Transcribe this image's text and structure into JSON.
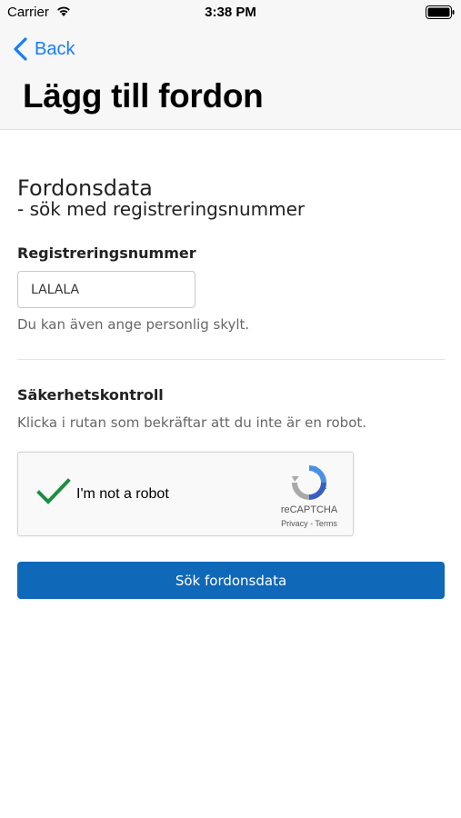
{
  "status_bar": {
    "carrier": "Carrier",
    "time": "3:38 PM",
    "wifi_icon": "wifi-icon",
    "battery_icon": "battery-icon"
  },
  "nav": {
    "back_label": "Back",
    "back_icon": "chevron-left-icon",
    "title": "Lägg till fordon",
    "accent_color": "#157efb"
  },
  "form": {
    "section_title": "Fordonsdata",
    "section_subtitle": "- sök med registreringsnummer",
    "registration": {
      "label": "Registreringsnummer",
      "value": "LALALA",
      "help": "Du kan även ange personlig skylt."
    },
    "security": {
      "label": "Säkerhetskontroll",
      "help": "Klicka i rutan som bekräftar att du inte är en robot.",
      "recaptcha": {
        "checkbox_label": "I'm not a robot",
        "checked": true,
        "brand": "reCAPTCHA",
        "links": "Privacy - Terms",
        "check_color": "#1e8e3e"
      }
    },
    "submit_label": "Sök fordonsdata",
    "submit_color": "#1068b8"
  }
}
